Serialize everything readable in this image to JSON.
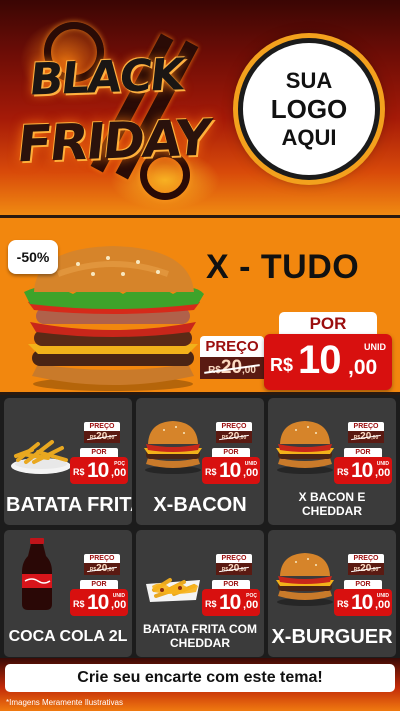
{
  "header": {
    "title_line1": "BLACK",
    "title_line2": "FRIDAY",
    "logo_line1": "SUA",
    "logo_line2": "LOGO",
    "logo_line3": "AQUI"
  },
  "featured": {
    "discount": "-50%",
    "name": "X - TUDO",
    "old_label": "PREÇO",
    "old_currency": "R$",
    "old_int": "20",
    "old_dec": ",00",
    "new_label": "POR",
    "currency": "R$",
    "price_int": "10",
    "price_dec": ",00",
    "unit": "UNID"
  },
  "products": [
    {
      "name": "BATATA FRITA",
      "old_label": "PREÇO",
      "old_currency": "R$",
      "old_int": "20",
      "old_dec": ",00",
      "new_label": "POR",
      "currency": "R$",
      "price_int": "10",
      "price_dec": ",00",
      "unit": "POÇ",
      "icon": "fries-icon"
    },
    {
      "name": "X-BACON",
      "old_label": "PREÇO",
      "old_currency": "R$",
      "old_int": "20",
      "old_dec": ",00",
      "new_label": "POR",
      "currency": "R$",
      "price_int": "10",
      "price_dec": ",00",
      "unit": "UNID",
      "icon": "burger-icon"
    },
    {
      "name": "X BACON E CHEDDAR",
      "old_label": "PREÇO",
      "old_currency": "R$",
      "old_int": "20",
      "old_dec": ",00",
      "new_label": "POR",
      "currency": "R$",
      "price_int": "10",
      "price_dec": ",00",
      "unit": "UNID",
      "icon": "burger-icon"
    },
    {
      "name": "COCA COLA 2L",
      "old_label": "PREÇO",
      "old_currency": "R$",
      "old_int": "20",
      "old_dec": ",00",
      "new_label": "POR",
      "currency": "R$",
      "price_int": "10",
      "price_dec": ",00",
      "unit": "UNID",
      "icon": "soda-bottle-icon"
    },
    {
      "name": "BATATA FRITA COM CHEDDAR",
      "old_label": "PREÇO",
      "old_currency": "R$",
      "old_int": "20",
      "old_dec": ",00",
      "new_label": "POR",
      "currency": "R$",
      "price_int": "10",
      "price_dec": ",00",
      "unit": "POÇ",
      "icon": "fries-cheddar-icon"
    },
    {
      "name": "X-BURGUER",
      "old_label": "PREÇO",
      "old_currency": "R$",
      "old_int": "20",
      "old_dec": ",00",
      "new_label": "POR",
      "currency": "R$",
      "price_int": "10",
      "price_dec": ",00",
      "unit": "UNID",
      "icon": "burger-icon"
    }
  ],
  "footer": {
    "cta": "Crie seu encarte com este tema!",
    "disclaimer": "*Imagens Meramente Ilustrativas"
  },
  "colors": {
    "accent_orange": "#f2870e",
    "price_red": "#d8100f",
    "card_gray": "#3b3b3b"
  }
}
